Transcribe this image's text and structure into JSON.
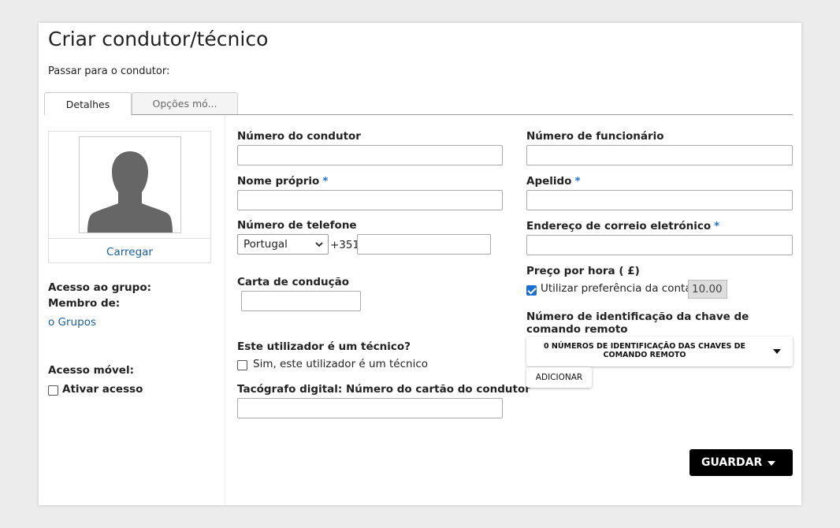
{
  "page": {
    "title": "Criar condutor/técnico",
    "subtitle": "Passar para o condutor:"
  },
  "tabs": [
    {
      "label": "Detalhes",
      "active": true
    },
    {
      "label": "Opções mó...",
      "active": false
    }
  ],
  "sidebar": {
    "upload_label": "Carregar",
    "group_access_label": "Acesso ao grupo:",
    "member_of_label": "Membro de:",
    "groups_link": "o Grupos",
    "mobile_access_label": "Acesso móvel:",
    "enable_access_label": "Ativar acesso",
    "enable_access_checked": false
  },
  "form": {
    "driver_number": {
      "label": "Número do condutor",
      "value": ""
    },
    "employee_number": {
      "label": "Número de funcionário",
      "value": ""
    },
    "first_name": {
      "label": "Nome próprio",
      "required_mark": "*",
      "value": ""
    },
    "last_name": {
      "label": "Apelido",
      "required_mark": "*",
      "value": ""
    },
    "phone": {
      "label": "Número de telefone",
      "country": "Portugal",
      "dial_code": "+351",
      "value": ""
    },
    "email": {
      "label": "Endereço de correio eletrónico",
      "required_mark": "*",
      "value": ""
    },
    "hourly_rate": {
      "label": "Preço por hora (  £)",
      "use_account_pref_label": "Utilizar preferência da conta",
      "use_account_pref_checked": true,
      "value": "10.00"
    },
    "license": {
      "label": "Carta de condução",
      "value": ""
    },
    "remote_key": {
      "label": "Número de identificação da chave de comando remoto",
      "dropdown_text": "0 NÚMEROS DE IDENTIFICAÇÃO DAS CHAVES DE COMANDO REMOTO",
      "add_label": "ADICIONAR"
    },
    "technician": {
      "question": "Este utilizador é um técnico?",
      "checkbox_label": "Sim, este utilizador é um técnico",
      "checked": false
    },
    "tachograph": {
      "label": "Tacógrafo digital: Número do cartão do condutor",
      "value": ""
    }
  },
  "actions": {
    "save_label": "GUARDAR"
  },
  "colors": {
    "accent": "#1a6fd1",
    "link": "#1a5fa0",
    "save_button": "#000000"
  }
}
